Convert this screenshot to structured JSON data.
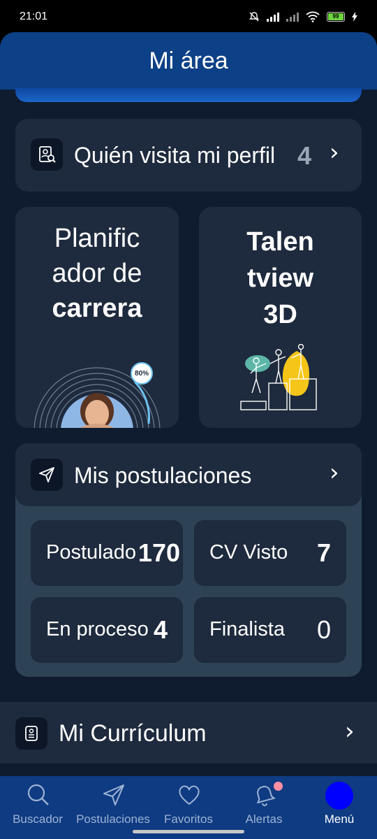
{
  "status": {
    "time": "21:01",
    "battery": "99"
  },
  "header": {
    "title": "Mi área"
  },
  "visitors": {
    "title": "Quién visita mi perfil",
    "count": "4"
  },
  "planner": {
    "line1": "Planific",
    "line2": "ador de",
    "line3": "carrera",
    "progress_label": "80%",
    "progress": 0.8
  },
  "talent": {
    "line1": "Talen",
    "line2": "tview",
    "line3": "3D"
  },
  "applications": {
    "title": "Mis postulaciones",
    "stats": [
      {
        "label": "Postulado",
        "value": "170"
      },
      {
        "label": "CV Visto",
        "value": "7"
      },
      {
        "label": "En proceso",
        "value": "4"
      },
      {
        "label": "Finalista",
        "value": "0"
      }
    ]
  },
  "cv": {
    "title": "Mi Currículum"
  },
  "nav": {
    "items": [
      {
        "label": "Buscador",
        "icon": "search-icon"
      },
      {
        "label": "Postulaciones",
        "icon": "send-icon"
      },
      {
        "label": "Favoritos",
        "icon": "heart-icon"
      },
      {
        "label": "Alertas",
        "icon": "bell-icon"
      },
      {
        "label": "Menú",
        "icon": "menu-avatar-icon"
      }
    ],
    "active": "Menú"
  },
  "colors": {
    "header": "#0d4187",
    "background": "#0f1c30",
    "card": "#1e2a3d",
    "accent_avatar": "#0000ff",
    "badge": "#ff8fa3"
  }
}
